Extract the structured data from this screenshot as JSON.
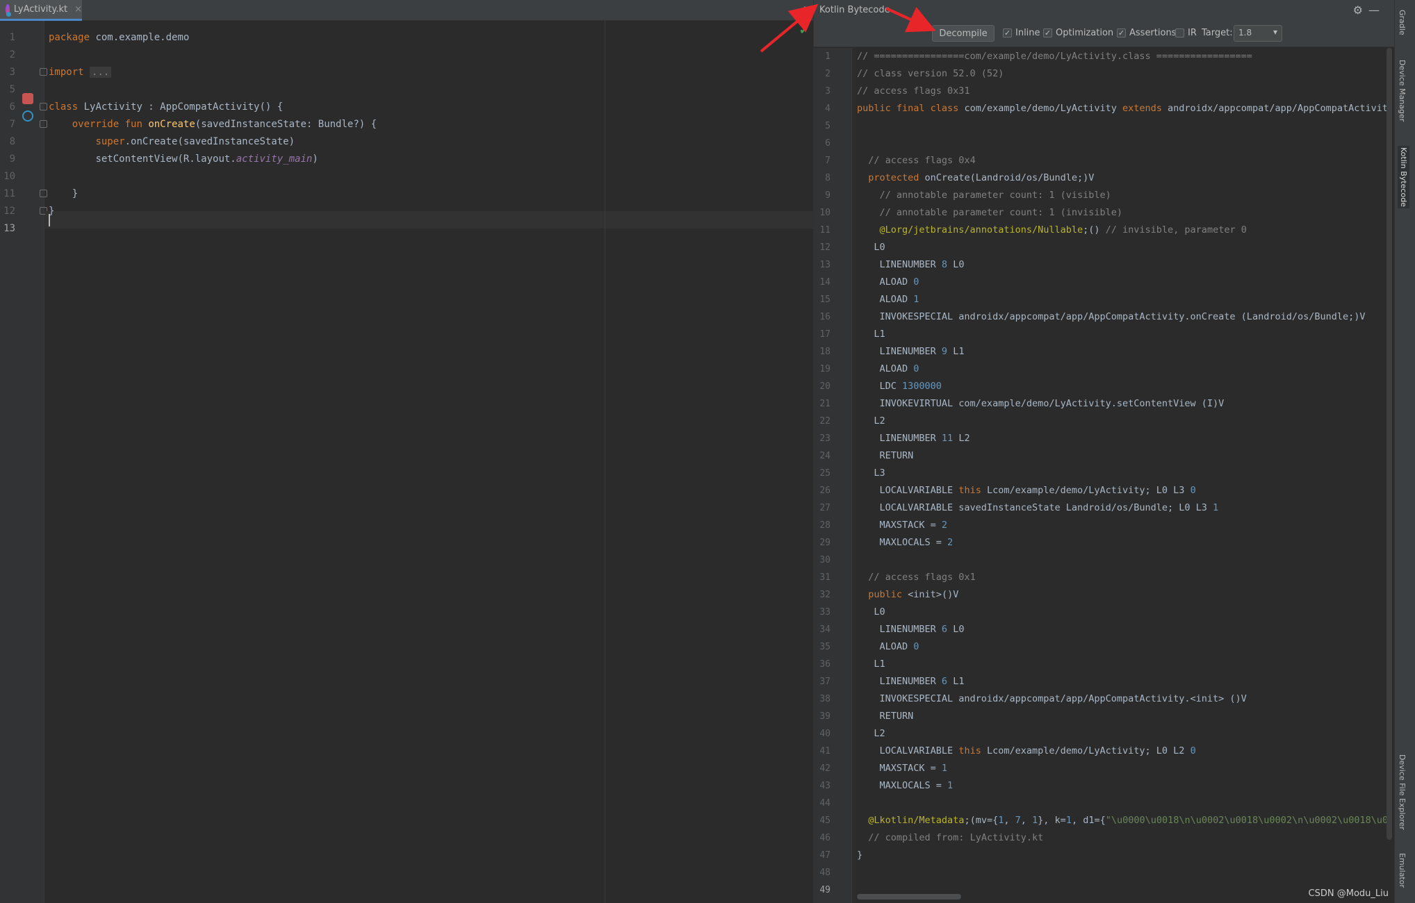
{
  "editor": {
    "tab_label": "LyActivity.kt",
    "tab_close": "×",
    "menu_glyph": "⋮",
    "check_glyph": "✔",
    "line_numbers": [
      "1",
      "2",
      "3",
      "5",
      "6",
      "7",
      "8",
      "9",
      "10",
      "11",
      "12",
      "13"
    ],
    "lines": {
      "l1_kw": "package",
      "l1_rest": " com.example.demo",
      "l3_kw": "import",
      "l3_dots": "...",
      "l6_kw": "class",
      "l6_rest": " LyActivity : AppCompatActivity() {",
      "l7_kw1": "override",
      "l7_kw2": "fun",
      "l7_fn": "onCreate",
      "l7_rest": "(savedInstanceState: Bundle?) {",
      "l8_kw": "super",
      "l8_rest": ".onCreate(savedInstanceState)",
      "l9_pre": "setContentView(R.layout.",
      "l9_it": "activity_main",
      "l9_post": ")",
      "l11": "}",
      "l12": "}"
    }
  },
  "bytecode_panel": {
    "title": "Kotlin Bytecode",
    "gear_glyph": "⚙",
    "minimize_glyph": "—",
    "decompile_label": "Decompile",
    "options": [
      {
        "label": "Inline",
        "checked": true
      },
      {
        "label": "Optimization",
        "checked": true
      },
      {
        "label": "Assertions",
        "checked": true
      },
      {
        "label": "IR",
        "checked": false
      }
    ],
    "ir_target_label": "Target:",
    "ir_target_value": "1.8",
    "check_glyph": "✓",
    "line_count": 49,
    "active_line": 49
  },
  "tool_strip": {
    "tabs": [
      "Gradle",
      "Device Manager",
      "Kotlin Bytecode",
      "Device File Explorer",
      "Emulator"
    ]
  },
  "watermark": "CSDN @Modu_Liu",
  "colors": {
    "background": "#2b2b2b",
    "keyword": "#cc7832",
    "function": "#ffc66d",
    "comment": "#808080",
    "number": "#6897bb",
    "string": "#6a8759",
    "annotation": "#bbb529",
    "arrow": "#e8262a"
  }
}
